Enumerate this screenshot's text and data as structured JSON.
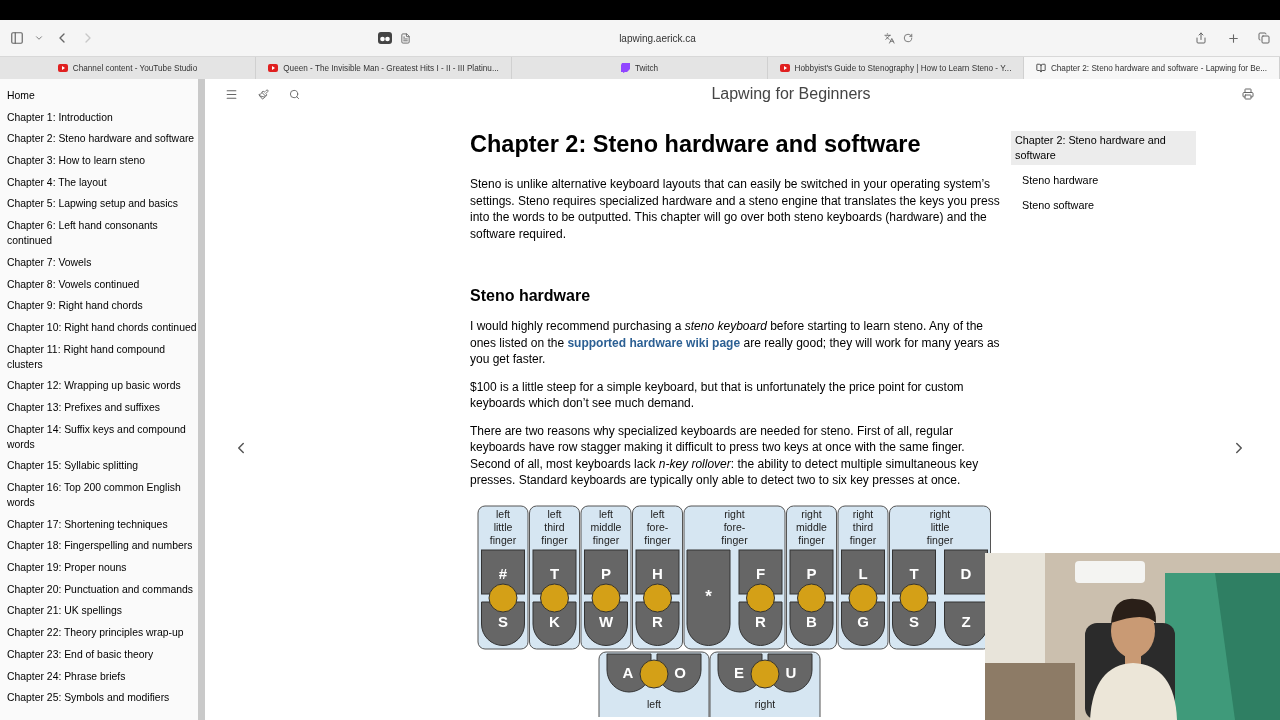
{
  "browser": {
    "url": "lapwing.aerick.ca",
    "back_disabled": false,
    "forward_disabled": true,
    "tabs": [
      {
        "title": "Channel content - YouTube Studio",
        "selected": false
      },
      {
        "title": "Queen - The Invisible Man - Greatest Hits I - II - III Platinu...",
        "selected": false
      },
      {
        "title": "Twitch",
        "selected": false
      },
      {
        "title": "Hobbyist's Guide to Stenography | How to Learn Steno - Y...",
        "selected": false
      },
      {
        "title": "Chapter 2: Steno hardware and software - Lapwing for Be...",
        "selected": true
      }
    ]
  },
  "sidebar": {
    "items": [
      "Home",
      "Chapter 1: Introduction",
      "Chapter 2: Steno hardware and software",
      "Chapter 3: How to learn steno",
      "Chapter 4: The layout",
      "Chapter 5: Lapwing setup and basics",
      "Chapter 6: Left hand consonants continued",
      "Chapter 7: Vowels",
      "Chapter 8: Vowels continued",
      "Chapter 9: Right hand chords",
      "Chapter 10: Right hand chords continued",
      "Chapter 11: Right hand compound clusters",
      "Chapter 12: Wrapping up basic words",
      "Chapter 13: Prefixes and suffixes",
      "Chapter 14: Suffix keys and compound words",
      "Chapter 15: Syllabic splitting",
      "Chapter 16: Top 200 common English words",
      "Chapter 17: Shortening techniques",
      "Chapter 18: Fingerspelling and numbers",
      "Chapter 19: Proper nouns",
      "Chapter 20: Punctuation and commands",
      "Chapter 21: UK spellings",
      "Chapter 22: Theory principles wrap-up",
      "Chapter 23: End of basic theory",
      "Chapter 24: Phrase briefs",
      "Chapter 25: Symbols and modifiers"
    ]
  },
  "book_title": "Lapwing for Beginners",
  "article": {
    "title": "Chapter 2: Steno hardware and software",
    "intro": "Steno is unlike alternative keyboard layouts that can easily be switched in your operating system’s settings. Steno requires specialized hardware and a steno engine that translates the keys you press into the words to be outputted. This chapter will go over both steno keyboards (hardware) and the software required.",
    "section_title": "Steno hardware",
    "paragraphs": [
      {
        "segments": [
          {
            "kind": "text",
            "text": "I would highly recommend purchasing a *steno keyboard* before starting to learn steno. Any of the ones listed on the "
          },
          {
            "kind": "link",
            "text": "supported hardware wiki page"
          },
          {
            "kind": "text",
            "text": " are really good; they will work for many years as you get faster."
          }
        ]
      },
      {
        "segments": [
          {
            "kind": "text",
            "text": "$100 is a little steep for a simple keyboard, but that is unfortunately the price point for custom keyboards which don’t see much demand."
          }
        ]
      },
      {
        "segments": [
          {
            "kind": "text",
            "text": "There are two reasons why specialized keyboards are needed for steno. First of all, regular keyboards have row stagger making it difficult to press two keys at once with the same finger. Second of all, most keyboards lack *n-key rollover*: the ability to detect multiple simultaneous key presses. Standard keyboards are typically only able to detect two to six key presses at once."
          }
        ]
      }
    ],
    "layout": {
      "fingers": [
        {
          "label": [
            "left",
            "little",
            "finger"
          ],
          "keys": [
            {
              "kind": "pair",
              "upper": "#",
              "lower": "S"
            }
          ]
        },
        {
          "label": [
            "left",
            "third",
            "finger"
          ],
          "keys": [
            {
              "kind": "pair",
              "upper": "T",
              "lower": "K"
            }
          ]
        },
        {
          "label": [
            "left",
            "middle",
            "finger"
          ],
          "keys": [
            {
              "kind": "pair",
              "upper": "P",
              "lower": "W"
            }
          ]
        },
        {
          "label": [
            "left",
            "fore-",
            "finger"
          ],
          "keys": [
            {
              "kind": "pair",
              "upper": "H",
              "lower": "R"
            }
          ]
        },
        {
          "label": [
            "right",
            "fore-",
            "finger"
          ],
          "keys": [
            {
              "kind": "tall",
              "upper": "*"
            },
            {
              "kind": "pair",
              "upper": "F",
              "lower": "R"
            }
          ]
        },
        {
          "label": [
            "right",
            "middle",
            "finger"
          ],
          "keys": [
            {
              "kind": "pair",
              "upper": "P",
              "lower": "B"
            }
          ]
        },
        {
          "label": [
            "right",
            "third",
            "finger"
          ],
          "keys": [
            {
              "kind": "pair",
              "upper": "L",
              "lower": "G"
            }
          ]
        },
        {
          "label": [
            "right",
            "little",
            "finger"
          ],
          "keys": [
            {
              "kind": "pair",
              "upper": "T",
              "lower": "S"
            },
            {
              "kind": "single",
              "upper": "D",
              "lower": "Z"
            }
          ]
        }
      ],
      "thumbs": [
        {
          "keys": [
            "A",
            "O"
          ],
          "label": "left"
        },
        {
          "keys": [
            "E",
            "U"
          ],
          "label": "right"
        }
      ]
    }
  },
  "toc": [
    {
      "text": "Chapter 2: Steno hardware and software",
      "selected": true,
      "sub": false
    },
    {
      "text": "Steno hardware",
      "selected": false,
      "sub": true
    },
    {
      "text": "Steno software",
      "selected": false,
      "sub": true
    }
  ]
}
